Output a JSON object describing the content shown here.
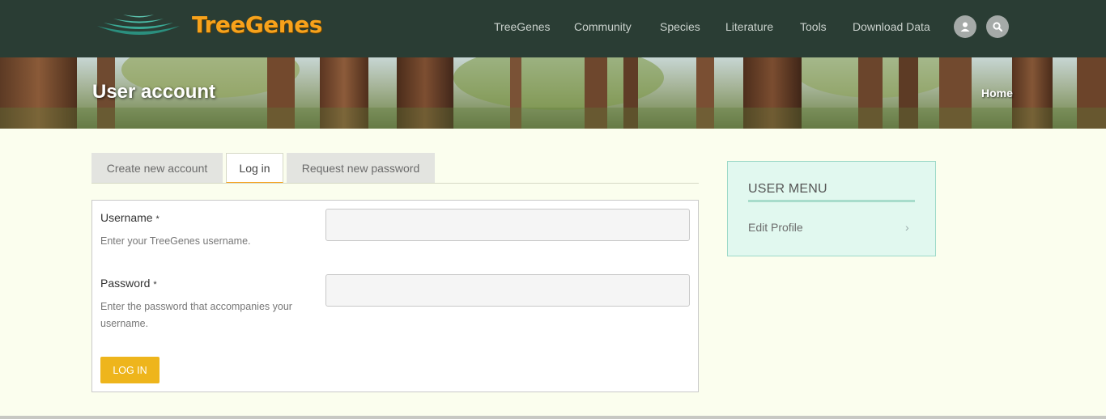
{
  "header": {
    "logo_text": "TreeGenes",
    "nav": [
      "TreeGenes",
      "Community",
      "Species",
      "Literature",
      "Tools",
      "Download Data"
    ],
    "icons": {
      "user": "user-icon",
      "search": "search-icon"
    }
  },
  "banner": {
    "title": "User account",
    "breadcrumb": "Home"
  },
  "tabs": [
    {
      "label": "Create new account",
      "active": false
    },
    {
      "label": "Log in",
      "active": true
    },
    {
      "label": "Request new password",
      "active": false
    }
  ],
  "form": {
    "username": {
      "label": "Username",
      "required_mark": "*",
      "help": "Enter your TreeGenes username.",
      "value": "",
      "placeholder": ""
    },
    "password": {
      "label": "Password",
      "required_mark": "*",
      "help_line1": "Enter the password that accompanies your",
      "help_line2": "username.",
      "value": "",
      "placeholder": ""
    },
    "submit_label": "LOG IN"
  },
  "user_menu": {
    "title": "USER MENU",
    "items": [
      {
        "label": "Edit Profile",
        "chevron": "›"
      }
    ]
  },
  "colors": {
    "header_bg": "#2a3d34",
    "logo_orange": "#f7a21b",
    "page_bg": "#fbfeee",
    "button_yellow": "#eeb51c",
    "menu_bg": "#e1f8ef"
  }
}
